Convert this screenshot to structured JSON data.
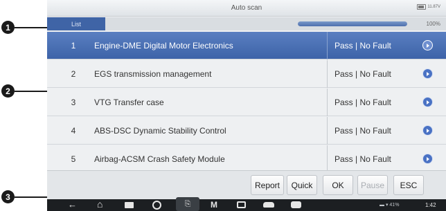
{
  "callouts": [
    "1",
    "2",
    "3"
  ],
  "title_bar": {
    "title": "Auto scan",
    "battery": "11.87V"
  },
  "tab_bar": {
    "tab": "List",
    "progress_percent": 100,
    "progress_label": "100%"
  },
  "systems": [
    {
      "num": "1",
      "name": "Engine-DME Digital Motor Electronics",
      "status": "Pass | No Fault",
      "selected": true
    },
    {
      "num": "2",
      "name": "EGS transmission management",
      "status": "Pass | No Fault",
      "selected": false
    },
    {
      "num": "3",
      "name": "VTG Transfer case",
      "status": "Pass | No Fault",
      "selected": false
    },
    {
      "num": "4",
      "name": "ABS-DSC Dynamic Stability Control",
      "status": "Pass | No Fault",
      "selected": false
    },
    {
      "num": "5",
      "name": "Airbag-ACSM Crash Safety Module",
      "status": "Pass | No Fault",
      "selected": false
    }
  ],
  "function_buttons": [
    {
      "label": "Report",
      "enabled": true
    },
    {
      "label": "Quick",
      "enabled": true
    },
    {
      "label": "OK",
      "enabled": true
    },
    {
      "label": "Pause",
      "enabled": false
    },
    {
      "label": "ESC",
      "enabled": true
    }
  ],
  "nav_icons": [
    "back-icon",
    "home-icon",
    "recent-apps-icon",
    "browser-icon",
    "vci-icon",
    "maxifix-icon",
    "car-icon",
    "car-side-icon",
    "car-search-icon"
  ],
  "status_bar": {
    "battery_level": "41%",
    "time": "1:42"
  },
  "colors": {
    "accent": "#3f64a6",
    "selected_row": "#4a6fb3",
    "nav_bar": "#1f2326"
  }
}
